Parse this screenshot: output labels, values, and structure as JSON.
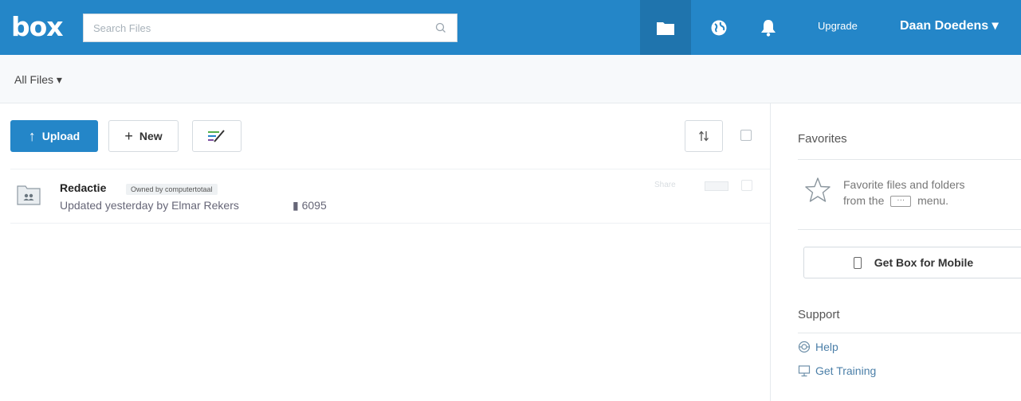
{
  "header": {
    "logo": "box",
    "search_placeholder": "Search Files",
    "upgrade_label": "Upgrade",
    "user_name": "Daan Doedens ▾",
    "brand_color": "#2486c8"
  },
  "breadcrumb": {
    "label": "All Files ▾"
  },
  "toolbar": {
    "upload_label": "Upload",
    "new_label": "New"
  },
  "files": [
    {
      "name": "Redactie",
      "owner_badge": "Owned by computertotaal",
      "meta": "Updated yesterday by Elmar Rekers",
      "count": "6095",
      "share_label": "Share"
    }
  ],
  "sidebar": {
    "favorites_title": "Favorites",
    "favorites_line1": "Favorite files and folders",
    "favorites_line2_a": "from the",
    "favorites_line2_b": "menu.",
    "mobile_button": "Get Box for Mobile",
    "support_title": "Support",
    "help_label": "Help",
    "training_label": "Get Training"
  }
}
